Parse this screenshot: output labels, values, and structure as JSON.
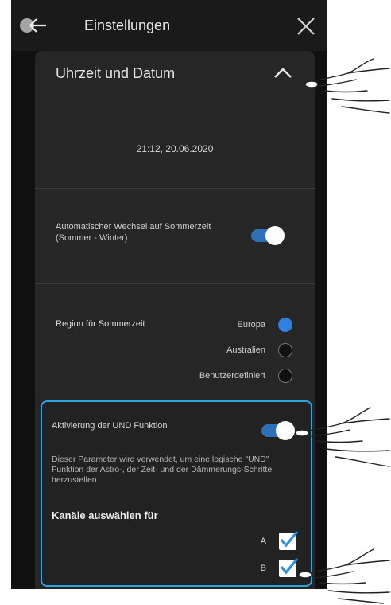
{
  "header": {
    "title": "Einstellungen",
    "back_icon": "arrow-left-icon",
    "close_icon": "close-icon"
  },
  "section": {
    "title": "Uhrzeit und Datum",
    "expanded": true
  },
  "datetime": "21:12, 20.06.2020",
  "auto_dst": {
    "label": "Automatischer Wechsel auf Sommerzeit (Sommer - Winter)",
    "enabled": true
  },
  "region": {
    "label": "Region für Sommerzeit",
    "options": [
      {
        "label": "Europa",
        "selected": true
      },
      {
        "label": "Australien",
        "selected": false
      },
      {
        "label": "Benutzerdefiniert",
        "selected": false
      }
    ]
  },
  "und_function": {
    "label": "Aktivierung der UND Funktion",
    "enabled": true,
    "description": "Dieser Parameter wird verwendet, um eine logische \"UND\" Funktion der Astro-, der Zeit- und der Dämmerungs-Schritte herzustellen.",
    "channels_title": "Kanäle auswählen für",
    "channels": [
      {
        "label": "A",
        "checked": true
      },
      {
        "label": "B",
        "checked": true
      }
    ]
  },
  "colors": {
    "accent": "#2f7fe0",
    "highlight_border": "#2fa3e6",
    "background": "#101010",
    "panel": "#262626"
  }
}
